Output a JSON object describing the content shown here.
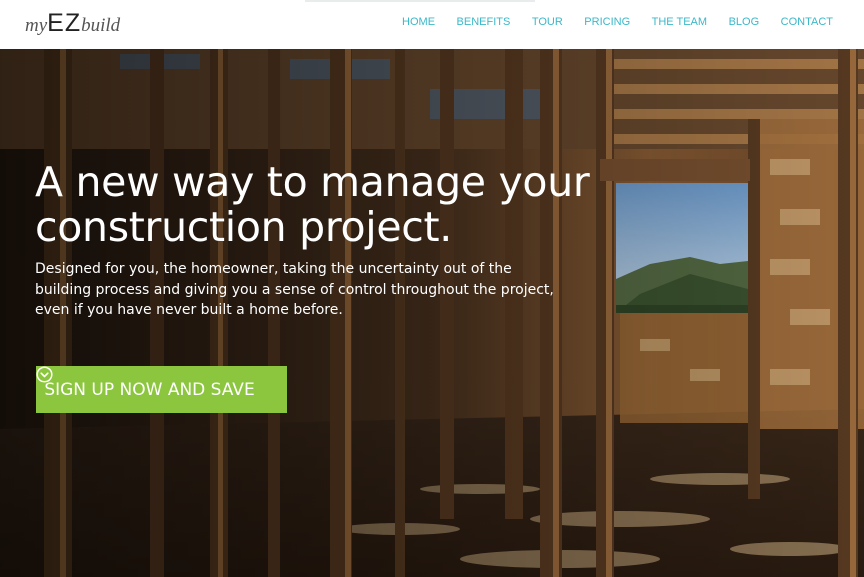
{
  "brand": {
    "logo_pre": "my",
    "logo_mid": "EZ",
    "logo_post": "build"
  },
  "nav": {
    "items": [
      "HOME",
      "BENEFITS",
      "TOUR",
      "PRICING",
      "THE TEAM",
      "BLOG",
      "CONTACT"
    ]
  },
  "hero": {
    "headline": "A new way to manage your construction project.",
    "subtext": "Designed for you, the homeowner, taking the uncertainty out of the building process and giving you a sense of control throughout the project, even if you have never built a home before.",
    "cta_label": "SIGN UP NOW AND SAVE",
    "cta_icon": "chevron-down-circle-icon"
  },
  "colors": {
    "nav_link": "#3bb8c9",
    "cta_background": "#8cc63f",
    "header_background": "#ffffff",
    "hero_text": "#ffffff"
  }
}
